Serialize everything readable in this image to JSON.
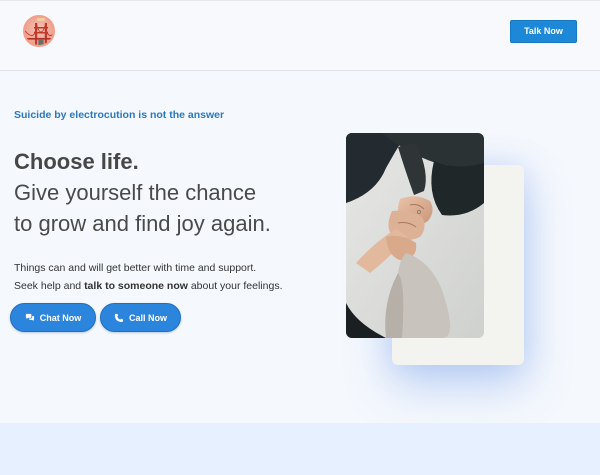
{
  "header": {
    "logo_icon": "golden-gate-bridge-logo",
    "talk_button_label": "Talk Now"
  },
  "hero": {
    "eyebrow": "Suicide by electrocution is not the answer",
    "heading_strong": "Choose life.",
    "heading_line2": "Give yourself the chance",
    "heading_line3": "to grow and find joy again.",
    "body_line1": "Things can and will get better with time and support.",
    "body_line2_pre": "Seek help and ",
    "body_line2_bold": "talk to someone now",
    "body_line2_post": " about your feelings.",
    "chat_button_label": "Chat Now",
    "call_button_label": "Call Now",
    "chat_icon": "chat-bubbles-icon",
    "call_icon": "phone-icon",
    "image_subject": "holding-hands-photo"
  },
  "colors": {
    "accent": "#1e88d8",
    "eyebrow": "#2a78bf",
    "page_bg": "#f5f8fd",
    "band_bg": "#e7f0fe"
  }
}
